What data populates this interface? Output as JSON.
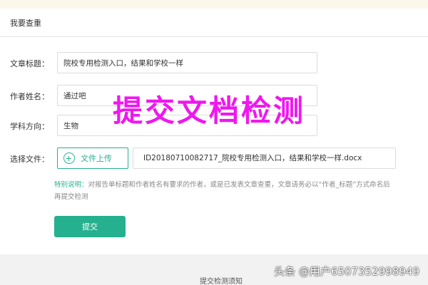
{
  "tab": {
    "label": "我要查重"
  },
  "form": {
    "title_label": "文章标题：",
    "title_value": "院校专用检测入口，结果和学校一样",
    "author_label": "作者姓名：",
    "author_value": "通过吧",
    "subject_label": "学科方向：",
    "subject_value": "生物",
    "file_label": "选择文件：",
    "upload_button": "文件上传",
    "file_name": "ID20180710082717_院校专用检测入口，结果和学校一样.docx"
  },
  "note": {
    "key": "特别说明：",
    "text": "对报告单标题和作者姓名有要求的作者，或是已发表文章查重，文章请务必以“作者_标题”方式命名后再提交检测"
  },
  "submit": {
    "label": "提交"
  },
  "footer": {
    "link": "提交检测须知"
  },
  "overlay": {
    "title": "提交文档检测"
  },
  "watermark": {
    "text": "头条 @用户6507352998949"
  },
  "colors": {
    "accent": "#25b08f",
    "overlay": "#ef17ef"
  },
  "icons": {
    "upload": "plus-circle-icon"
  }
}
